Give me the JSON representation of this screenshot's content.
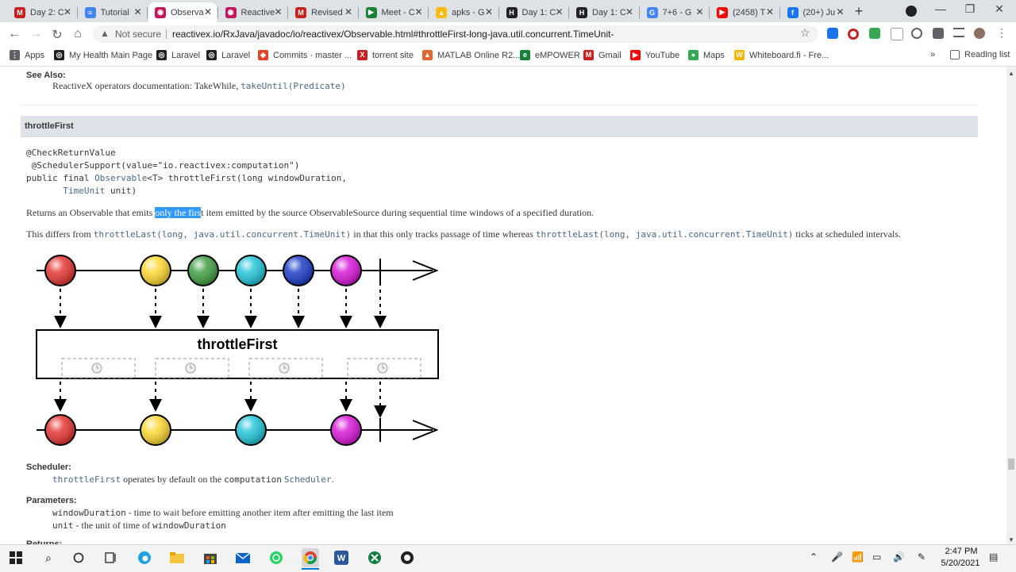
{
  "browser": {
    "tabs": [
      {
        "title": "Day 2: C",
        "favicon_color": "#c5221f",
        "favicon_letter": "M"
      },
      {
        "title": "Tutorial",
        "favicon_color": "#4285f4",
        "favicon_letter": "≡"
      },
      {
        "title": "Observa",
        "favicon_color": "#c2185b",
        "favicon_letter": "◉",
        "active": true
      },
      {
        "title": "Reactive",
        "favicon_color": "#c2185b",
        "favicon_letter": "◉"
      },
      {
        "title": "Revised",
        "favicon_color": "#c5221f",
        "favicon_letter": "M"
      },
      {
        "title": "Meet - C",
        "favicon_color": "#188038",
        "favicon_letter": "▶"
      },
      {
        "title": "apks - G",
        "favicon_color": "#fbbc04",
        "favicon_letter": "▲"
      },
      {
        "title": "Day 1: C",
        "favicon_color": "#202124",
        "favicon_letter": "H"
      },
      {
        "title": "Day 1: C",
        "favicon_color": "#202124",
        "favicon_letter": "H"
      },
      {
        "title": "7+6 - G",
        "favicon_color": "#4285f4",
        "favicon_letter": "G"
      },
      {
        "title": "(2458) T",
        "favicon_color": "#ff0000",
        "favicon_letter": "▶"
      },
      {
        "title": "(20+) Ju",
        "favicon_color": "#1877f2",
        "favicon_letter": "f"
      }
    ],
    "omnibox": {
      "security": "Not secure",
      "url": "reactivex.io/RxJava/javadoc/io/reactivex/Observable.html#throttleFirst-long-java.util.concurrent.TimeUnit-"
    },
    "bookmarks": [
      {
        "label": "Apps",
        "color": "#5f6368",
        "icon": "⋮"
      },
      {
        "label": "My Health Main Page",
        "color": "#202124",
        "icon": "◎"
      },
      {
        "label": "Laravel",
        "color": "#202124",
        "icon": "◎"
      },
      {
        "label": "Laravel",
        "color": "#202124",
        "icon": "◎"
      },
      {
        "label": "Commits · master ...",
        "color": "#e24329",
        "icon": "◆"
      },
      {
        "label": "torrent site",
        "color": "#c5221f",
        "icon": "X"
      },
      {
        "label": "MATLAB Online R2...",
        "color": "#e16737",
        "icon": "▲"
      },
      {
        "label": "eMPOWER",
        "color": "#188038",
        "icon": "e"
      },
      {
        "label": "Gmail",
        "color": "#c5221f",
        "icon": "M"
      },
      {
        "label": "YouTube",
        "color": "#ff0000",
        "icon": "▶"
      },
      {
        "label": "Maps",
        "color": "#34a853",
        "icon": "●"
      },
      {
        "label": "Whiteboard.fi - Fre...",
        "color": "#f4b400",
        "icon": "W"
      }
    ],
    "bookmarks_more": "»",
    "reading_list": "Reading list"
  },
  "doc": {
    "see_also_heading": "See Also:",
    "see_also_text": "ReactiveX operators documentation: TakeWhile, ",
    "see_also_code": "takeUntil(Predicate)",
    "method_name": "throttleFirst",
    "signature": {
      "line1": "@CheckReturnValue",
      "line2": " @SchedulerSupport(value=\"io.reactivex:computation\")",
      "line3a": "public final ",
      "line3b": "Observable",
      "line3c": "<T> throttleFirst(long windowDuration,",
      "line4a": "       ",
      "line4b": "TimeUnit",
      "line4c": " unit)"
    },
    "desc1_before": "Returns an Observable that emits ",
    "desc1_highlight": "only the firs",
    "desc1_after": "t item emitted by the source ObservableSource during sequential time windows of a specified duration.",
    "desc2_a": "This differs from ",
    "desc2_code1": "throttleLast(long, java.util.concurrent.TimeUnit)",
    "desc2_b": " in that this only tracks passage of time whereas ",
    "desc2_code2": "throttleLast(long, java.util.concurrent.TimeUnit)",
    "desc2_c": " ticks at scheduled intervals.",
    "diagram_label": "throttleFirst",
    "input_marbles": [
      "#e53935",
      "#fdd835",
      "#43a047",
      "#26c6da",
      "#1e40c8",
      "#d81bd8"
    ],
    "output_marbles": [
      "#e53935",
      "#fdd835",
      "#26c6da",
      "#d81bd8"
    ],
    "scheduler_heading": "Scheduler:",
    "scheduler_code1": "throttleFirst",
    "scheduler_text1": " operates by default on the ",
    "scheduler_code2": "computation",
    "scheduler_code3": "Scheduler",
    "scheduler_end": ".",
    "params_heading": "Parameters:",
    "param1_name": "windowDuration",
    "param1_desc": " - time to wait before emitting another item after emitting the last item",
    "param2_name": "unit",
    "param2_desc": " - the unit of time of ",
    "param2_code": "windowDuration",
    "returns_heading": "Returns:"
  },
  "taskbar": {
    "time": "2:47 PM",
    "date": "5/20/2021"
  }
}
